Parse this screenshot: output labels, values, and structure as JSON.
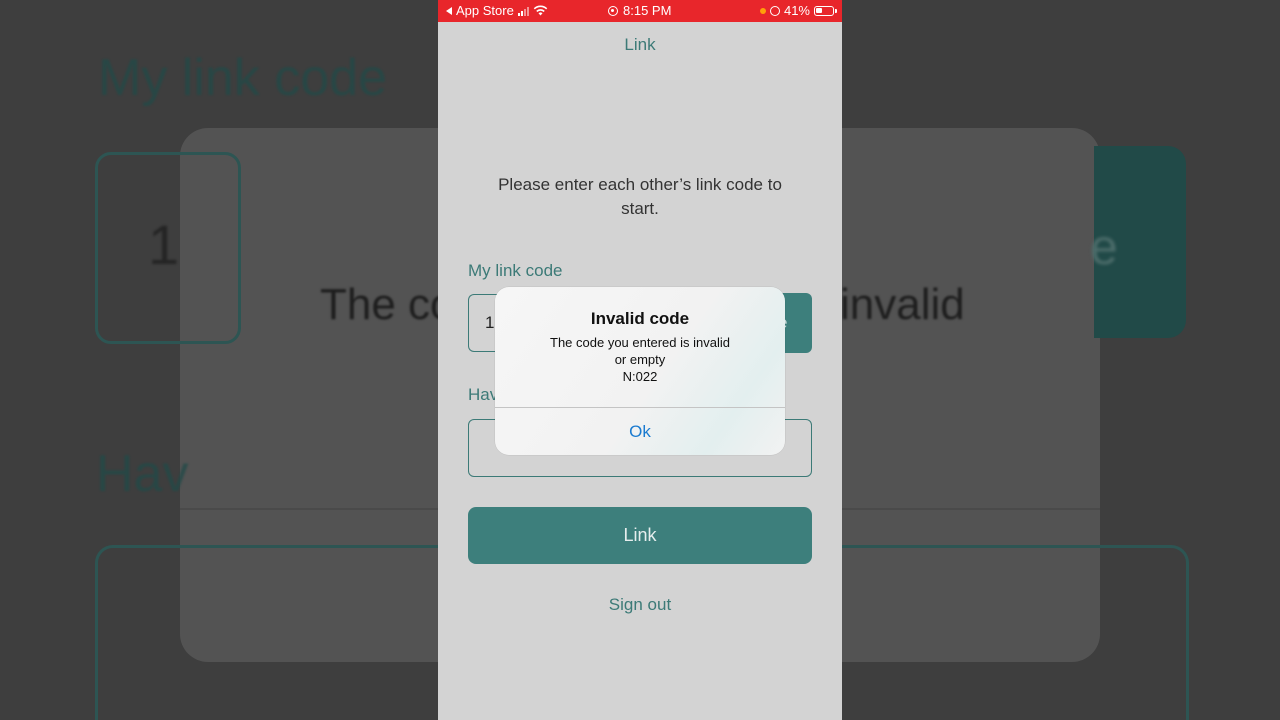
{
  "background": {
    "title_fragment": "My link code",
    "digit_fragment": "1",
    "message_left": "The co",
    "message_right": "invalid",
    "button_fragment": "e",
    "have_fragment": "Hav"
  },
  "status_bar": {
    "back_app": "App Store",
    "time": "8:15 PM",
    "battery_percent": "41%",
    "battery_level": 0.41
  },
  "nav": {
    "title": "Link"
  },
  "main": {
    "instructions": "Please enter each other’s link code to start.",
    "my_code_label": "My link code",
    "my_code_value": "1",
    "share_button_fragment": "e",
    "partner_label_fragment": "Hav",
    "partner_code_value": "",
    "link_button": "Link",
    "sign_out": "Sign out"
  },
  "alert": {
    "title": "Invalid code",
    "message_line1": "The code you entered is invalid",
    "message_line2": "or empty",
    "message_line3": "N:022",
    "ok_button": "Ok"
  },
  "colors": {
    "accent": "#3c7a77",
    "button": "#3d7f7c",
    "status_bar": "#e8262b",
    "alert_action": "#1a7bd0"
  }
}
